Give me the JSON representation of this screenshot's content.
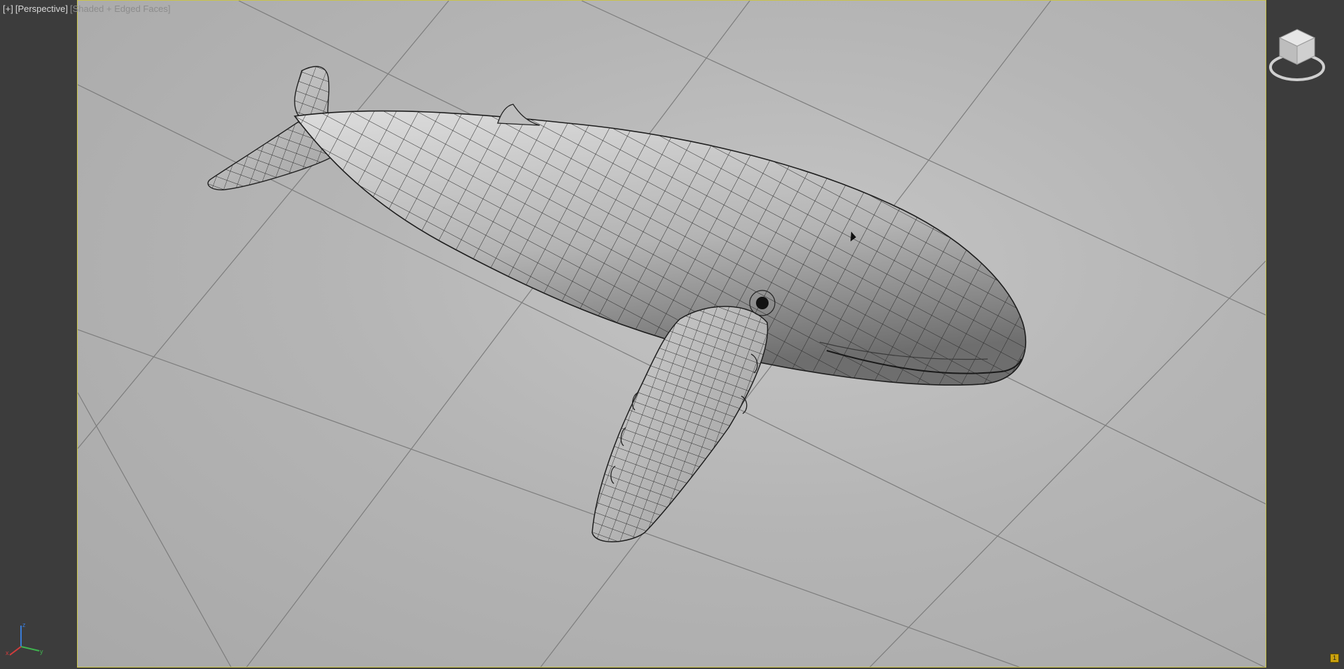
{
  "viewport": {
    "menu_label": "[+]",
    "view_label": "[Perspective]",
    "shading_label": "[Shaded + Edged Faces]"
  },
  "viewcube": {
    "icon": "viewcube-icon"
  },
  "axis_tripod": {
    "icon": "axis-tripod-icon",
    "axes": [
      "x",
      "y",
      "z"
    ]
  },
  "corner_badge": {
    "label": "1",
    "color": "#caa10f"
  },
  "scene": {
    "model": "humpback-whale-mesh",
    "frame_color": "#c9c34a",
    "grid_color": "#7a7a7a"
  }
}
